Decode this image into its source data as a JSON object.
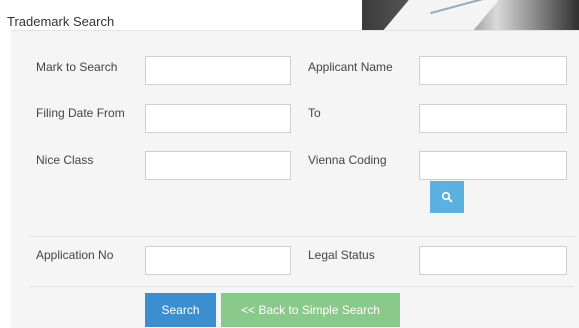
{
  "header": {
    "title": "Trademark Search"
  },
  "form": {
    "mark_to_search": {
      "label": "Mark to Search",
      "value": ""
    },
    "applicant_name": {
      "label": "Applicant Name",
      "value": ""
    },
    "filing_date_from": {
      "label": "Filing Date From",
      "value": ""
    },
    "filing_date_to": {
      "label": "To",
      "value": ""
    },
    "nice_class": {
      "label": "Nice Class",
      "value": ""
    },
    "vienna_coding": {
      "label": "Vienna Coding",
      "value": ""
    },
    "application_no": {
      "label": "Application No",
      "value": ""
    },
    "legal_status": {
      "label": "Legal Status",
      "value": ""
    }
  },
  "buttons": {
    "search": "Search",
    "back": "<< Back to Simple Search"
  },
  "icons": {
    "vienna_lookup": "search-icon"
  },
  "colors": {
    "search_button": "#3b8ed0",
    "back_button": "#89c98a",
    "lookup_button": "#5bb0e0",
    "panel_background": "#f5f5f5"
  }
}
